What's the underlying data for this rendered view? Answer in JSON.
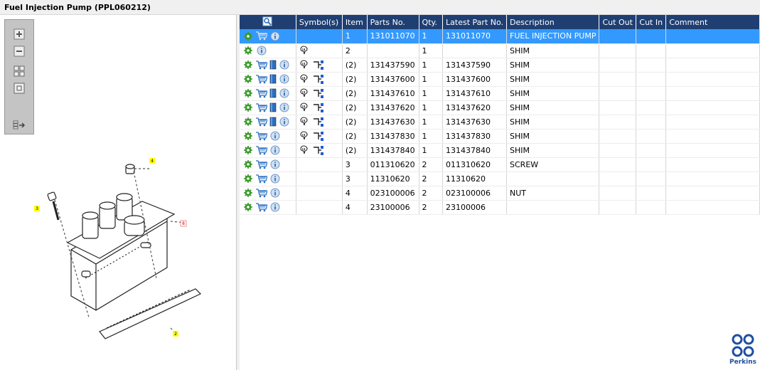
{
  "window": {
    "title": "Fuel Injection Pump (PPL060212)"
  },
  "toolbar": {
    "buttons": [
      "zoom-in",
      "zoom-out",
      "fit-page",
      "actual-size",
      "export"
    ]
  },
  "diagram": {
    "callouts": [
      "4",
      "3",
      "8",
      "2"
    ]
  },
  "grid": {
    "columns": [
      "",
      "Symbol(s)",
      "Item",
      "Parts No.",
      "Qty.",
      "Latest Part No.",
      "Description",
      "Cut Out",
      "Cut In",
      "Comment"
    ],
    "rows": [
      {
        "icons": [
          "gear",
          "cart-gray",
          "info"
        ],
        "symbols": [],
        "item": "1",
        "part": "131011070",
        "qty": "1",
        "latest": "131011070",
        "desc": "FUEL INJECTION PUMP",
        "selected": true
      },
      {
        "icons": [
          "gear",
          "info"
        ],
        "symbols": [
          "pin"
        ],
        "item": "2",
        "part": "",
        "qty": "1",
        "latest": "",
        "desc": "SHIM"
      },
      {
        "icons": [
          "gear",
          "cart",
          "book",
          "info"
        ],
        "symbols": [
          "pin",
          "tree"
        ],
        "item": "(2)",
        "part": "131437590",
        "qty": "1",
        "latest": "131437590",
        "desc": "SHIM"
      },
      {
        "icons": [
          "gear",
          "cart",
          "book",
          "info"
        ],
        "symbols": [
          "pin",
          "tree"
        ],
        "item": "(2)",
        "part": "131437600",
        "qty": "1",
        "latest": "131437600",
        "desc": "SHIM"
      },
      {
        "icons": [
          "gear",
          "cart",
          "book",
          "info"
        ],
        "symbols": [
          "pin",
          "tree"
        ],
        "item": "(2)",
        "part": "131437610",
        "qty": "1",
        "latest": "131437610",
        "desc": "SHIM"
      },
      {
        "icons": [
          "gear",
          "cart",
          "book",
          "info"
        ],
        "symbols": [
          "pin",
          "tree"
        ],
        "item": "(2)",
        "part": "131437620",
        "qty": "1",
        "latest": "131437620",
        "desc": "SHIM"
      },
      {
        "icons": [
          "gear",
          "cart",
          "book",
          "info"
        ],
        "symbols": [
          "pin",
          "tree"
        ],
        "item": "(2)",
        "part": "131437630",
        "qty": "1",
        "latest": "131437630",
        "desc": "SHIM"
      },
      {
        "icons": [
          "gear",
          "cart",
          "info"
        ],
        "symbols": [
          "pin",
          "tree"
        ],
        "item": "(2)",
        "part": "131437830",
        "qty": "1",
        "latest": "131437830",
        "desc": "SHIM"
      },
      {
        "icons": [
          "gear",
          "cart",
          "info"
        ],
        "symbols": [
          "pin",
          "tree"
        ],
        "item": "(2)",
        "part": "131437840",
        "qty": "1",
        "latest": "131437840",
        "desc": "SHIM"
      },
      {
        "icons": [
          "gear",
          "cart",
          "info"
        ],
        "symbols": [],
        "item": "3",
        "part": "011310620",
        "qty": "2",
        "latest": "011310620",
        "desc": "SCREW"
      },
      {
        "icons": [
          "gear",
          "cart",
          "info"
        ],
        "symbols": [],
        "item": "3",
        "part": "11310620",
        "qty": "2",
        "latest": "11310620",
        "desc": ""
      },
      {
        "icons": [
          "gear",
          "cart",
          "info"
        ],
        "symbols": [],
        "item": "4",
        "part": "023100006",
        "qty": "2",
        "latest": "023100006",
        "desc": "NUT"
      },
      {
        "icons": [
          "gear",
          "cart",
          "info"
        ],
        "symbols": [],
        "item": "4",
        "part": "23100006",
        "qty": "2",
        "latest": "23100006",
        "desc": ""
      }
    ]
  },
  "brand": {
    "name": "Perkins",
    "color": "#1f4fa0"
  },
  "colors": {
    "header": "#1f3f73",
    "selected": "#3399ff"
  }
}
